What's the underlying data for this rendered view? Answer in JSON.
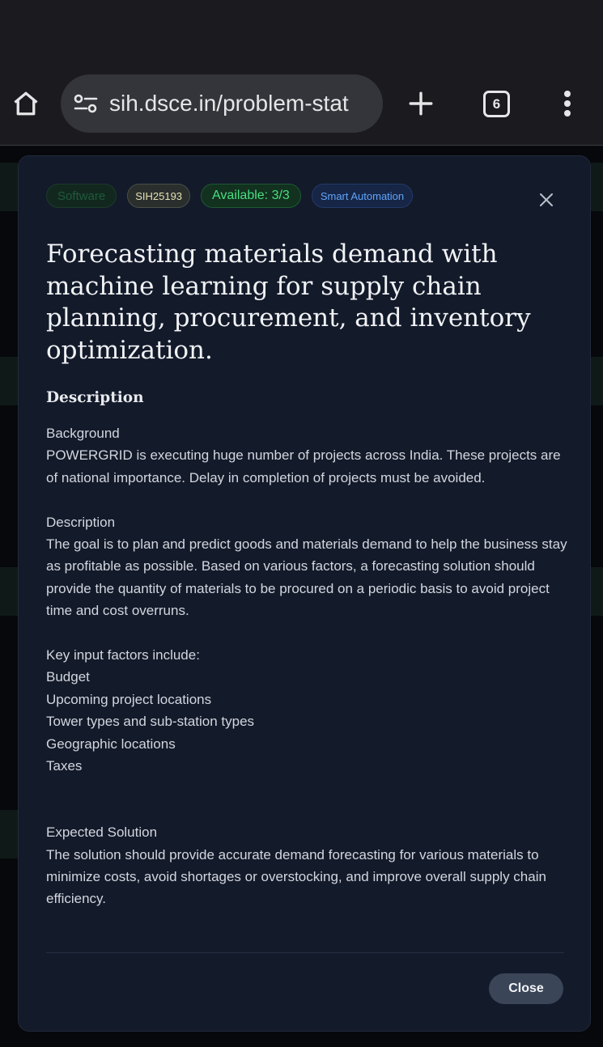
{
  "browser": {
    "url": "sih.dsce.in/problem-stat",
    "tab_count": "6"
  },
  "modal": {
    "tags": {
      "category_type": "Software",
      "problem_id": "SIH25193",
      "availability": "Available: 3/3",
      "theme": "Smart Automation"
    },
    "title": "Forecasting materials demand with machine learning for supply chain planning, procurement, and inventory optimization.",
    "section_heading": "Description",
    "description": {
      "background_heading": "Background",
      "background_text": "POWERGRID is executing huge number of projects across India. These projects are of national importance. Delay in completion of projects must be avoided.",
      "description_heading": "Description",
      "description_text": "The goal is to plan and predict goods and materials demand to help the business stay as profitable as possible. Based on various factors, a forecasting solution should provide the quantity of materials to be procured on a periodic basis to avoid project time and cost overruns.",
      "factors_heading": "Key input factors include:",
      "factors": [
        "Budget",
        "Upcoming project locations",
        "Tower types and sub-station types",
        "Geographic locations",
        "Taxes"
      ],
      "solution_heading": "Expected Solution",
      "solution_text": "The solution should provide accurate demand forecasting for various materials to minimize costs, avoid shortages or overstocking, and improve overall supply chain efficiency."
    },
    "close_label": "Close"
  },
  "colors": {
    "modal_bg": "#131a2a",
    "available_green": "#4ade80",
    "theme_blue": "#60a5fa"
  }
}
